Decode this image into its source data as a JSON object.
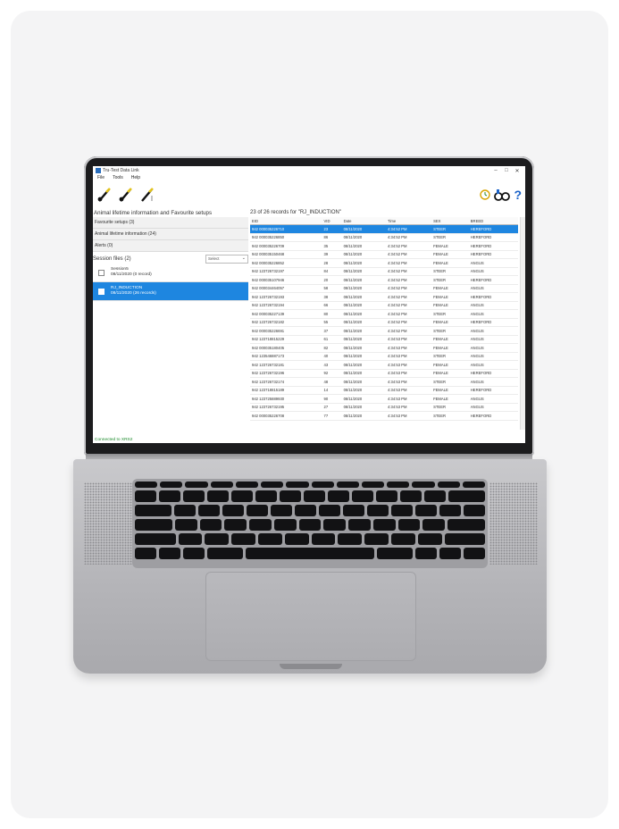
{
  "window": {
    "title": "Tru-Test Data Link",
    "minimize": "–",
    "maximize": "□",
    "close": "✕"
  },
  "menu": [
    "File",
    "Tools",
    "Help"
  ],
  "toolbar": {
    "help_glyph": "?"
  },
  "left": {
    "title": "Animal lifetime information and Favourite setups",
    "rows": [
      "Favourite setups (3)",
      "Animal lifetime information (24)",
      "Alerts (0)"
    ],
    "sessions_title": "Session files (2)",
    "select_label": "Select",
    "sessions": [
      {
        "name": "Session5",
        "sub": "08/11/2020  (0 record)"
      },
      {
        "name": "RJ_INDUCTION",
        "sub": "08/11/2020  (26 records)"
      }
    ],
    "status": "Connected to XRS2"
  },
  "right": {
    "title": "23 of 26 records for \"RJ_INDUCTION\"",
    "columns": [
      "EID",
      "VID",
      "Date",
      "Time",
      "SEX",
      "BREED"
    ],
    "rows": [
      [
        "942 000035226710",
        "23",
        "08/11/2020",
        "4:34:52 PM",
        "STEER",
        "HEREFORD"
      ],
      [
        "942 000035226850",
        "86",
        "08/11/2020",
        "4:34:52 PM",
        "STEER",
        "HEREFORD"
      ],
      [
        "942 000035226709",
        "35",
        "08/11/2020",
        "4:34:52 PM",
        "FEMALE",
        "HEREFORD"
      ],
      [
        "942 000035150468",
        "39",
        "08/11/2020",
        "4:34:52 PM",
        "FEMALE",
        "HEREFORD"
      ],
      [
        "942 000035226852",
        "28",
        "08/11/2020",
        "4:34:52 PM",
        "FEMALE",
        "ANGUS"
      ],
      [
        "942 123726732197",
        "84",
        "08/11/2020",
        "4:34:52 PM",
        "STEER",
        "ANGUS"
      ],
      [
        "942 000035107946",
        "20",
        "08/11/2020",
        "4:34:52 PM",
        "STEER",
        "HEREFORD"
      ],
      [
        "942 000034464057",
        "58",
        "08/11/2020",
        "4:34:52 PM",
        "FEMALE",
        "ANGUS"
      ],
      [
        "942 123726732193",
        "38",
        "08/11/2020",
        "4:34:52 PM",
        "FEMALE",
        "HEREFORD"
      ],
      [
        "942 123726732194",
        "66",
        "08/11/2020",
        "4:34:52 PM",
        "FEMALE",
        "ANGUS"
      ],
      [
        "942 000035227139",
        "80",
        "08/11/2020",
        "4:34:52 PM",
        "STEER",
        "ANGUS"
      ],
      [
        "942 123726732182",
        "55",
        "08/11/2020",
        "4:34:52 PM",
        "FEMALE",
        "HEREFORD"
      ],
      [
        "942 000035226691",
        "37",
        "08/11/2020",
        "4:34:52 PM",
        "STEER",
        "ANGUS"
      ],
      [
        "942 123718815229",
        "61",
        "08/11/2020",
        "4:34:53 PM",
        "FEMALE",
        "ANGUS"
      ],
      [
        "942 000035180405",
        "82",
        "08/11/2020",
        "4:34:53 PM",
        "FEMALE",
        "ANGUS"
      ],
      [
        "942 123546887173",
        "40",
        "08/11/2020",
        "4:34:53 PM",
        "STEER",
        "ANGUS"
      ],
      [
        "942 123726732181",
        "43",
        "08/11/2020",
        "4:34:53 PM",
        "FEMALE",
        "ANGUS"
      ],
      [
        "942 123726732196",
        "92",
        "08/11/2020",
        "4:34:53 PM",
        "FEMALE",
        "HEREFORD"
      ],
      [
        "942 123726732174",
        "48",
        "08/11/2020",
        "4:34:53 PM",
        "STEER",
        "ANGUS"
      ],
      [
        "942 123718815189",
        "14",
        "08/11/2020",
        "4:34:53 PM",
        "FEMALE",
        "HEREFORD"
      ],
      [
        "942 123725889930",
        "90",
        "08/11/2020",
        "4:34:53 PM",
        "FEMALE",
        "ANGUS"
      ],
      [
        "942 123726732195",
        "27",
        "08/11/2020",
        "4:34:53 PM",
        "STEER",
        "ANGUS"
      ],
      [
        "942 000035226708",
        "77",
        "08/11/2020",
        "4:34:53 PM",
        "STEER",
        "HEREFORD"
      ]
    ]
  },
  "colors": {
    "accent": "#1e86e0",
    "status": "#1a8a2a"
  }
}
